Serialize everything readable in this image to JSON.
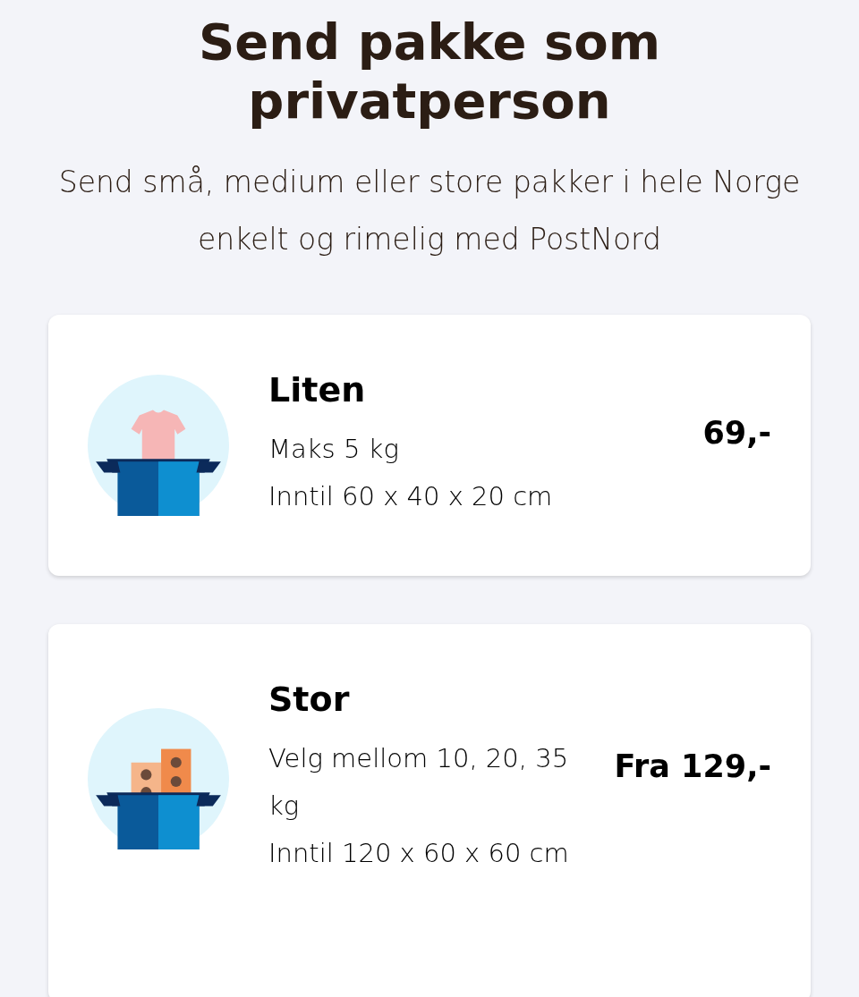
{
  "header": {
    "title": "Send pakke som privatperson",
    "subtitle": "Send små, medium eller store pakker i hele Norge enkelt og rimelig med PostNord"
  },
  "cards": [
    {
      "title": "Liten",
      "lines": [
        "Maks 5 kg",
        "Inntil 60 x 40 x 20 cm"
      ],
      "price": "69,-"
    },
    {
      "title": "Stor",
      "lines": [
        "Velg mellom 10, 20, 35 kg",
        "Inntil 120 x 60 x 60 cm"
      ],
      "price": "Fra 129,-"
    }
  ]
}
